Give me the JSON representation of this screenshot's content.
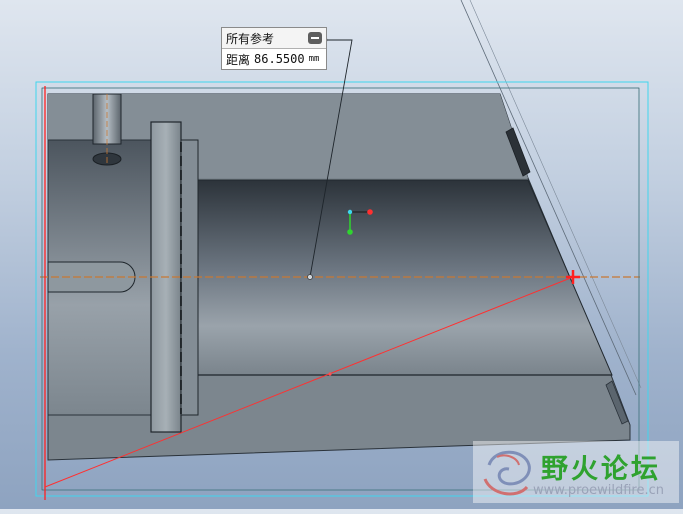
{
  "measurement": {
    "header_label": "所有参考",
    "distance_label": "距离",
    "distance_value": "86.5500",
    "unit": "mm"
  },
  "watermark": {
    "title": "野火论坛",
    "url": "www.proewildfire.cn"
  },
  "colors": {
    "background_top": "#dfe6ef",
    "background_bottom": "#8ea3c0",
    "model_body": "#7d878f",
    "bore_dark": "#2e353c",
    "selection_frame": "#3fd6ee",
    "reference_red": "#ff2020",
    "axis_orange": "#c87833",
    "watermark_green": "#2fa22f"
  },
  "icons": {
    "collapse": "collapse-icon",
    "watermark_logo": "swirl-logo-icon"
  }
}
